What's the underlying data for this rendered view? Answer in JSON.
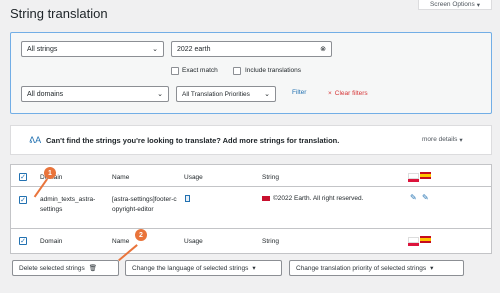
{
  "screen_options": "Screen Options",
  "page_title": "String translation",
  "filters": {
    "strings_select": "All strings",
    "search_value": "2022 earth",
    "exact_match": "Exact match",
    "include_translations": "Include translations",
    "domains_select": "All domains",
    "priorities_select": "All Translation Priorities",
    "filter_button": "Filter",
    "clear_filters": "Clear filters"
  },
  "notice": {
    "text": "Can't find the strings you're looking to translate? Add more strings for translation.",
    "more_details": "more details"
  },
  "table": {
    "headers": {
      "domain": "Domain",
      "name": "Name",
      "usage": "Usage",
      "string": "String"
    },
    "row": {
      "domain": "admin_texts_astra-settings",
      "name": "[astra-settings]footer-copyright-editor",
      "string": "©2022 Earth. All right reserved."
    },
    "footer_headers": {
      "domain": "Domain",
      "name": "Name",
      "usage": "Usage",
      "string": "String"
    }
  },
  "badges": {
    "one": "1",
    "two": "2"
  },
  "actions": {
    "delete": "Delete selected strings",
    "change_language": "Change the language of selected strings",
    "change_priority": "Change translation priority of selected strings"
  },
  "colors": {
    "accent": "#2271b1",
    "badge": "#e9743b",
    "clear": "#d63638"
  }
}
